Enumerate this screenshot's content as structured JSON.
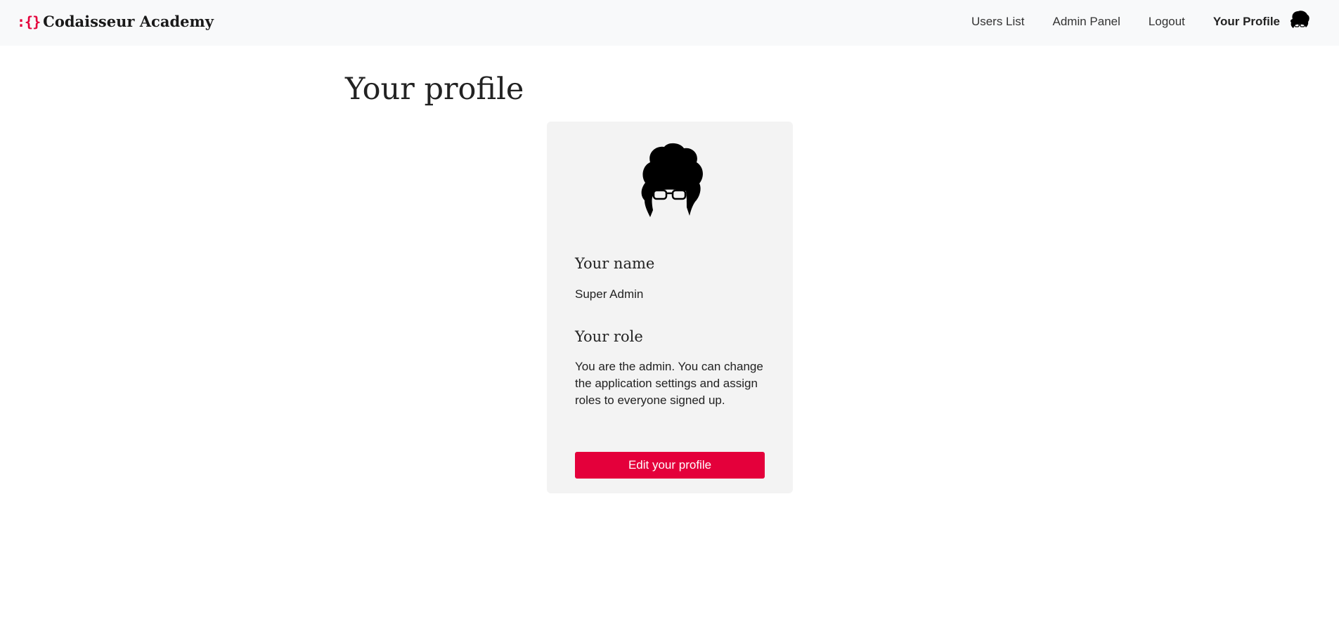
{
  "navbar": {
    "brand_mark": ":{}",
    "brand_name": "Codaisseur Academy",
    "links": [
      {
        "label": "Users List"
      },
      {
        "label": "Admin Panel"
      },
      {
        "label": "Logout"
      },
      {
        "label": "Your Profile"
      }
    ],
    "avatar_icon": "afro-avatar-icon"
  },
  "main": {
    "title": "Your profile",
    "card": {
      "avatar_icon": "afro-avatar-icon",
      "name_heading": "Your name",
      "name_value": "Super Admin",
      "role_heading": "Your role",
      "role_value": "You are the admin. You can change the application settings and assign roles to everyone signed up.",
      "edit_button_label": "Edit your profile"
    }
  },
  "colors": {
    "accent": "#e4003b",
    "navbar_bg": "#f8f9fa",
    "card_bg": "#f3f3f3"
  }
}
